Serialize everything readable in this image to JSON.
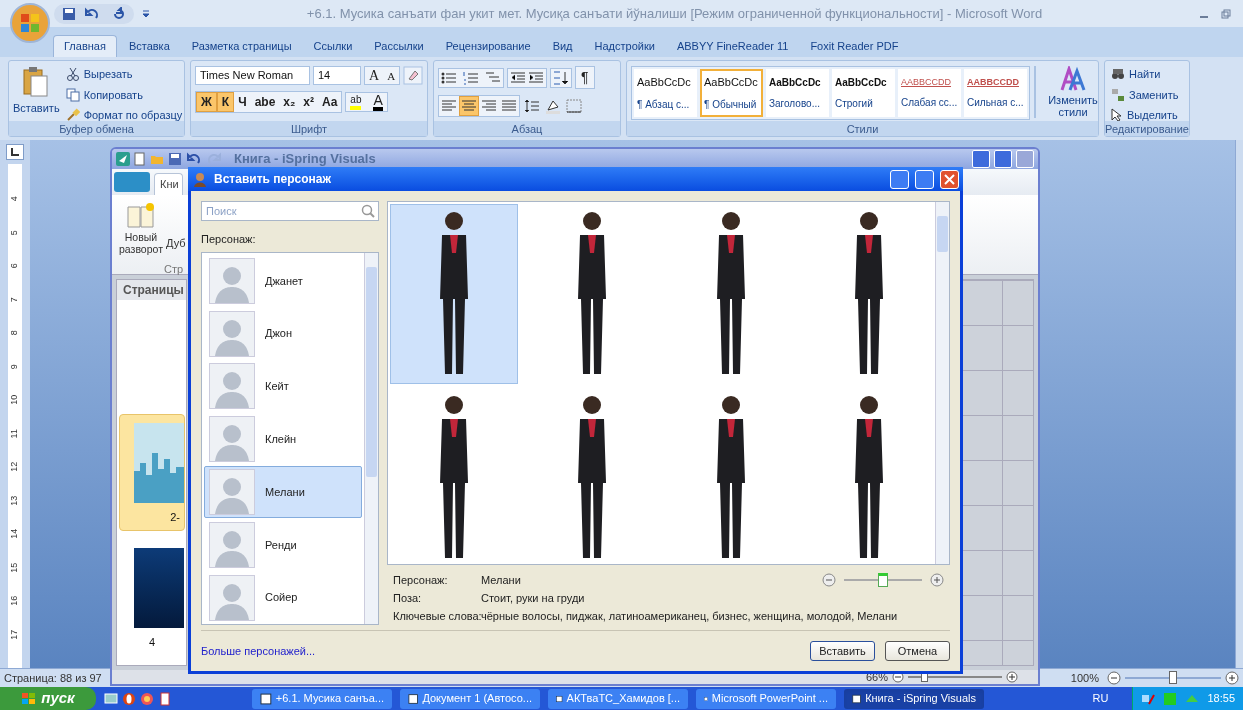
{
  "word_window": {
    "title": "+6.1. Мусика санъати фан укит мет. Мусиқа санъати йўналиши [Режим ограниченной функциональности] - Microsoft Word"
  },
  "ribbon_tabs": [
    {
      "label": "Главная",
      "selected": true
    },
    {
      "label": "Вставка",
      "selected": false
    },
    {
      "label": "Разметка страницы",
      "selected": false
    },
    {
      "label": "Ссылки",
      "selected": false
    },
    {
      "label": "Рассылки",
      "selected": false
    },
    {
      "label": "Рецензирование",
      "selected": false
    },
    {
      "label": "Вид",
      "selected": false
    },
    {
      "label": "Надстройки",
      "selected": false
    },
    {
      "label": "ABBYY FineReader 11",
      "selected": false
    },
    {
      "label": "Foxit Reader PDF",
      "selected": false
    }
  ],
  "clipboard_group": {
    "label": "Буфер обмена",
    "paste": "Вставить",
    "cut": "Вырезать",
    "copy": "Копировать",
    "format_painter": "Формат по образцу"
  },
  "font_group": {
    "label": "Шрифт",
    "font_name": "Times New Roman",
    "font_size": "14",
    "size_buttons": [
      "A",
      "A"
    ],
    "format_buttons": [
      {
        "label": "Ж",
        "selected": true
      },
      {
        "label": "К",
        "selected": true
      },
      {
        "label": "Ч",
        "selected": false
      },
      {
        "label": "abe",
        "selected": false
      },
      {
        "label": "x₂",
        "selected": false
      },
      {
        "label": "x²",
        "selected": false
      },
      {
        "label": "Aa",
        "selected": false
      }
    ],
    "highlight": "ab",
    "font_color": "A"
  },
  "paragraph_group": {
    "label": "Абзац",
    "pilcrow": "¶",
    "alignments": [
      {
        "selected": false
      },
      {
        "selected": true
      },
      {
        "selected": false
      },
      {
        "selected": false
      }
    ]
  },
  "styles_group": {
    "label": "Стили",
    "change_styles": "Изменить стили",
    "styles": [
      {
        "preview": "AaBbCcDc",
        "name": "¶ Абзац с...",
        "kind": "normal",
        "selected": false
      },
      {
        "preview": "AaBbCcDc",
        "name": "¶ Обычный",
        "kind": "normal",
        "selected": true
      },
      {
        "preview": "AaBbCcDc",
        "name": "Заголово...",
        "kind": "bold",
        "selected": false
      },
      {
        "preview": "AaBbCcDc",
        "name": "Строгий",
        "kind": "bold",
        "selected": false
      },
      {
        "preview": "AABBCCDD",
        "name": "Слабая сс...",
        "kind": "reference",
        "selected": false
      },
      {
        "preview": "AABBCCDD",
        "name": "Сильная с...",
        "kind": "strong_reference",
        "selected": false
      }
    ]
  },
  "editing_group": {
    "label": "Редактирование",
    "find": "Найти",
    "replace": "Заменить",
    "select": "Выделить"
  },
  "ruler_marks": [
    "4",
    "5",
    "6",
    "7",
    "8",
    "9",
    "10",
    "11",
    "12",
    "13",
    "14",
    "15",
    "16",
    "17"
  ],
  "status_bar": {
    "page": "Страница: 88 из 97",
    "zoom": "100%",
    "zoom_slider": {
      "level": 0.5
    }
  },
  "ispring_window": {
    "title": "Книга - iSpring Visuals",
    "tab": "Кни",
    "new_spread": "Новый разворот",
    "cut_label": "Дуб",
    "group_label": "Стр",
    "pages_panel": "Страницы",
    "thumbnails": [
      {
        "label": "2-",
        "selected": true,
        "kind": "city"
      },
      {
        "label": "4",
        "selected": false,
        "kind": "dark"
      }
    ],
    "zoom": "66%",
    "zoom_slider": {
      "level": 0.17
    }
  },
  "dialog": {
    "title": "Вставить персонаж",
    "search": {
      "placeholder": "Поиск"
    },
    "list_label": "Персонаж:",
    "characters": [
      {
        "name": "Джанет",
        "selected": false
      },
      {
        "name": "Джон",
        "selected": false
      },
      {
        "name": "Кейт",
        "selected": false
      },
      {
        "name": "Клейн",
        "selected": false
      },
      {
        "name": "Мелани",
        "selected": true
      },
      {
        "name": "Ренди",
        "selected": false
      },
      {
        "name": "Сойер",
        "selected": false
      }
    ],
    "poses": [
      {
        "selected": true
      },
      {
        "selected": false
      },
      {
        "selected": false
      },
      {
        "selected": false
      },
      {
        "selected": false
      },
      {
        "selected": false
      },
      {
        "selected": false
      },
      {
        "selected": false
      }
    ],
    "info": [
      {
        "label": "Персонаж:",
        "value": "Мелани"
      },
      {
        "label": "Поза:",
        "value": "Стоит, руки на груди"
      },
      {
        "label": "Ключевые слова:",
        "value": "чёрные волосы, пиджак, латиноамериканец, бизнес, женщина, молодой, Мелани"
      }
    ],
    "size_slider": {
      "level": 0.5
    },
    "more_link": "Больше персонажей...",
    "buttons": [
      "Вставить",
      "Отмена"
    ]
  },
  "taskbar": {
    "start": "пуск",
    "tasks": [
      {
        "label": "+6.1. Мусика санъа...",
        "selected": false
      },
      {
        "label": "Документ 1 (Автосо...",
        "selected": false
      },
      {
        "label": "АКТваТС_Хамидов [...",
        "selected": false
      },
      {
        "label": "Microsoft PowerPoint ...",
        "selected": false
      },
      {
        "label": "Книга - iSpring Visuals",
        "selected": true
      }
    ],
    "language": "RU",
    "time": "18:55"
  }
}
